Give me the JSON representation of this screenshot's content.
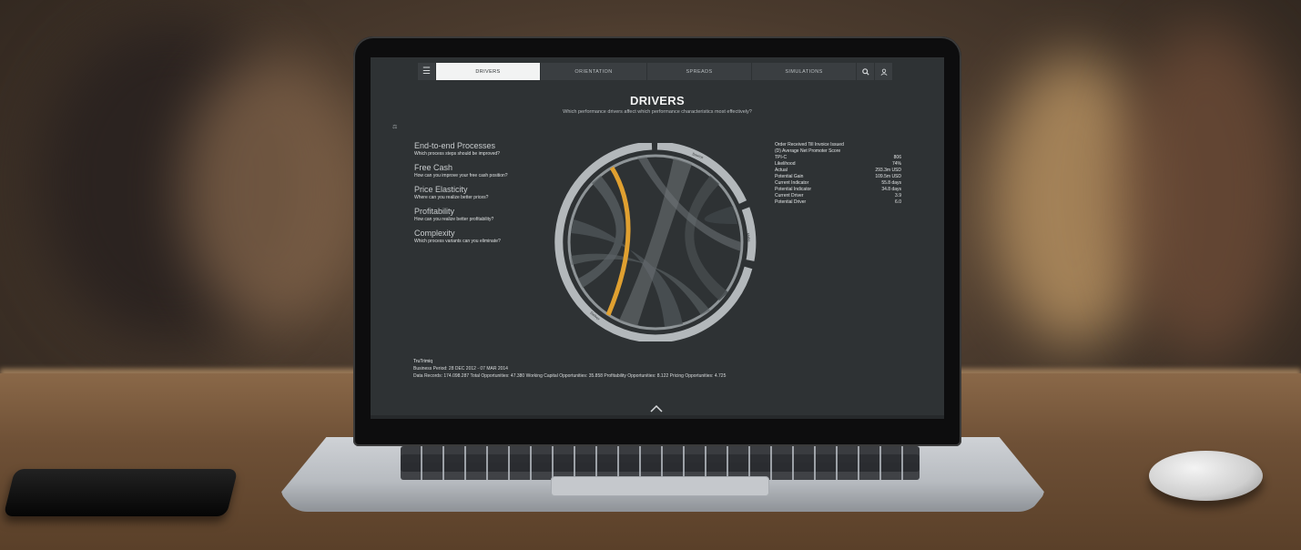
{
  "nav": {
    "tabs": [
      "DRIVERS",
      "ORIENTATION",
      "SPREADS",
      "SIMULATIONS"
    ],
    "active_tab": "DRIVERS"
  },
  "icons": {
    "menu": "menu-icon",
    "search": "search-icon",
    "user": "user-icon",
    "expand": "chevron-up-icon"
  },
  "page": {
    "title": "DRIVERS",
    "subtitle": "Which performance drivers affect which performance characteristics most effectively?",
    "side_glyph": "⚖"
  },
  "questions": [
    {
      "title": "End-to-end Processes",
      "sub": "Which process steps should be improved?"
    },
    {
      "title": "Free Cash",
      "sub": "How can you improve your free cash position?"
    },
    {
      "title": "Price Elasticity",
      "sub": "Where can you realize better prices?"
    },
    {
      "title": "Profitability",
      "sub": "How can you realize better profitability?"
    },
    {
      "title": "Complexity",
      "sub": "Which process variants can you eliminate?"
    }
  ],
  "details": {
    "heading1": "Order Received Till Invoice Issued",
    "heading2": "(D) Average Net Promoter Score",
    "rows": [
      {
        "label": "TPI-C",
        "value": "806"
      },
      {
        "label": "Likelihood",
        "value": "74%"
      },
      {
        "label": "Actual",
        "value": "293.3m USD"
      },
      {
        "label": "Potential Gain",
        "value": "109.5m USD"
      },
      {
        "label": "Current Indicator",
        "value": "55.8 days"
      },
      {
        "label": "Potential Indicator",
        "value": "34.8 days"
      },
      {
        "label": "Current Driver",
        "value": "3.9"
      },
      {
        "label": "Potential Driver",
        "value": "6.0"
      }
    ]
  },
  "chord_labels": [
    "Source",
    "Make",
    "Deliver"
  ],
  "footer": {
    "brand": "TruTrimiq",
    "period": "Business Period: 28 DEC 2012 - 07 MAR 2014",
    "stats": "Data Records: 174.098.287    Total Opportunities: 47.380    Working Capital Opportunities: 35.858    Profitability Opportunities: 8.122    Pricing Opportunities: 4.725"
  },
  "colors": {
    "screen_bg": "#2e3234",
    "accent": "#e0a030",
    "ring": "#b3b8bb"
  }
}
